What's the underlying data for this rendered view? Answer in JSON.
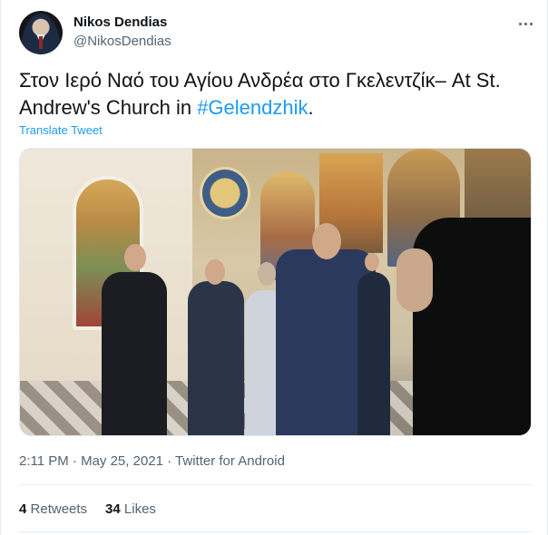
{
  "tweet": {
    "author_name": "Nikos Dendias",
    "author_handle": "@NikosDendias",
    "text_before": "Στον Ιερό Ναό του Αγίου Ανδρέα στο Γκελεντζίκ– At St. Andrew's Church in ",
    "hashtag": "#Gelendzhik",
    "text_after": ".",
    "translate_label": "Translate Tweet",
    "timestamp": "2:11 PM · May 25, 2021 · Twitter for Android",
    "retweets_count": "4",
    "retweets_label": "Retweets",
    "likes_count": "34",
    "likes_label": "Likes"
  },
  "colors": {
    "link": "#1d9bf0",
    "secondary_text": "#536471",
    "primary_text": "#0f1419"
  },
  "icons": {
    "more": "more-options-icon"
  }
}
